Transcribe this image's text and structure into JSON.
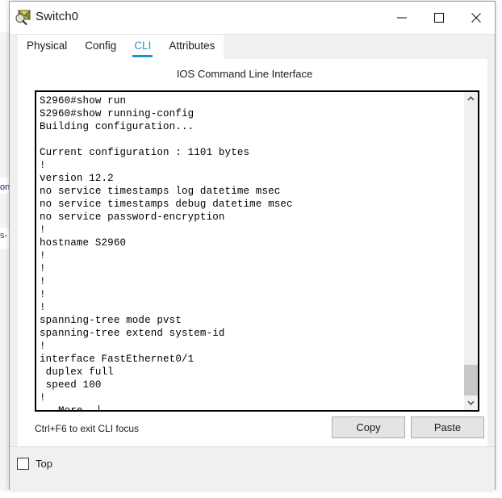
{
  "window": {
    "title": "Switch0",
    "icon": "inspect-envelope-icon",
    "controls": {
      "minimize": "minimize-icon",
      "maximize": "maximize-icon",
      "close": "close-icon"
    }
  },
  "tabs": [
    {
      "label": "Physical",
      "active": false
    },
    {
      "label": "Config",
      "active": false
    },
    {
      "label": "CLI",
      "active": true
    },
    {
      "label": "Attributes",
      "active": false
    }
  ],
  "content": {
    "heading": "IOS Command Line Interface",
    "hint": "Ctrl+F6 to exit CLI focus",
    "buttons": {
      "copy": "Copy",
      "paste": "Paste"
    }
  },
  "terminal": {
    "lines": [
      "S2960#show run",
      "S2960#show running-config",
      "Building configuration...",
      "",
      "Current configuration : 1101 bytes",
      "!",
      "version 12.2",
      "no service timestamps log datetime msec",
      "no service timestamps debug datetime msec",
      "no service password-encryption",
      "!",
      "hostname S2960",
      "!",
      "!",
      "!",
      "!",
      "!",
      "spanning-tree mode pvst",
      "spanning-tree extend system-id",
      "!",
      "interface FastEthernet0/1",
      " duplex full",
      " speed 100",
      "!",
      " --More--"
    ],
    "prompt_hostname": "S2960",
    "more_prompt": " --More--",
    "scrollbar": {
      "up_arrow": "chevron-up-icon",
      "down_arrow": "chevron-down-icon"
    }
  },
  "bottom": {
    "top_checkbox_label": "Top",
    "top_checkbox_checked": false
  },
  "backdrop": {
    "fragment_1": "on",
    "fragment_2": "s-"
  },
  "colors": {
    "accent": "#1a93d4",
    "window_bg": "#f0f0f0",
    "panel_bg": "#ffffff",
    "terminal_text": "#000000",
    "button_face": "#e4e4e4",
    "scroll_thumb": "#c8c8c8"
  }
}
